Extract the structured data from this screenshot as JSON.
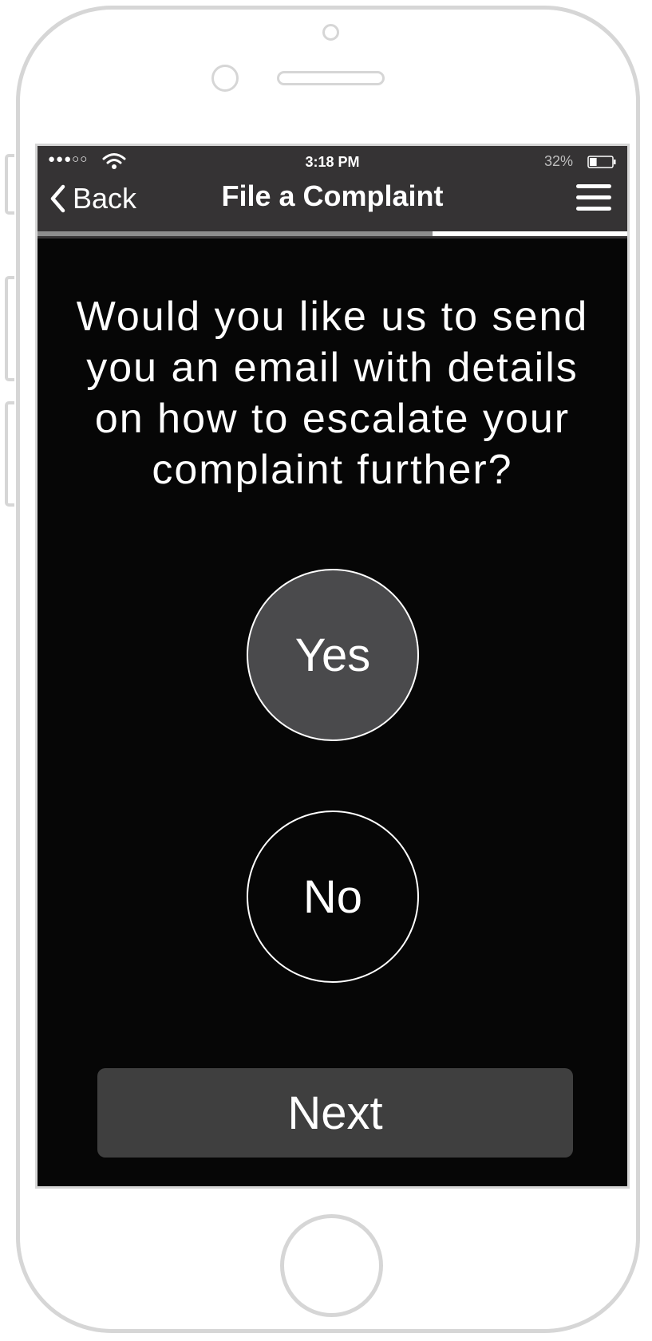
{
  "status_bar": {
    "signal": "●●●○○",
    "time": "3:18 PM",
    "battery_percent": "32%",
    "battery_level": 0.32,
    "icons": [
      "wifi-icon",
      "battery-icon"
    ]
  },
  "nav": {
    "back_label": "Back",
    "title": "File a Complaint",
    "icons": [
      "chevron-left-icon",
      "hamburger-menu-icon"
    ]
  },
  "progress": {
    "fraction": 0.67
  },
  "main": {
    "question": "Would you like us to send you an email with details on how to escalate your complaint further?",
    "options": [
      {
        "label": "Yes",
        "selected": true
      },
      {
        "label": "No",
        "selected": false
      }
    ],
    "next_label": "Next"
  },
  "colors": {
    "screen_background": "#060606",
    "top_bar": "#353334",
    "selected_option": "#4a4a4c",
    "next_button": "#3f3f3f",
    "progress_fill": "#8d8d8d",
    "progress_track": "#ffffff",
    "device_outline": "#d6d6d6"
  }
}
